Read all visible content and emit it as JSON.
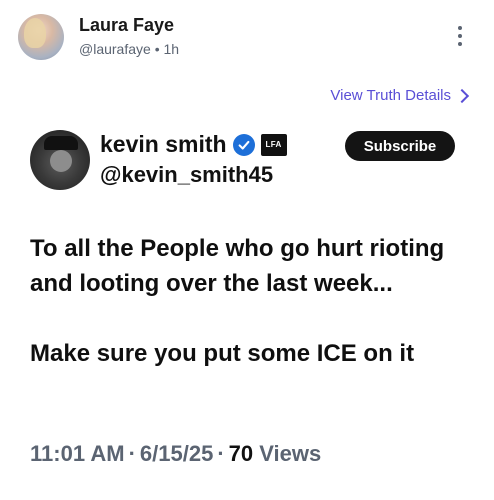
{
  "author": {
    "name": "Laura Faye",
    "handle": "@laurafaye",
    "time": "1h",
    "separator": "•"
  },
  "view_details": {
    "label": "View Truth Details"
  },
  "quoted": {
    "name": "kevin smith",
    "handle": "@kevin_smith45",
    "logo_text": "LFA",
    "subscribe_label": "Subscribe"
  },
  "post": {
    "line1": "To all the People who go hurt rioting and looting over the last week...",
    "line2": "Make sure you put some ICE on it"
  },
  "meta": {
    "time": "11:01 AM",
    "date": "6/15/25",
    "views_count": "70",
    "views_label": "Views",
    "separator": "·"
  },
  "colors": {
    "accent_link": "#5a4fd6",
    "verified_badge": "#1d6fd8",
    "subscribe_bg": "#141414",
    "muted_text": "#5b6472"
  },
  "icons": {
    "more": "more-vertical-icon",
    "chevron": "chevron-right-icon",
    "verified": "verified-badge-icon"
  }
}
